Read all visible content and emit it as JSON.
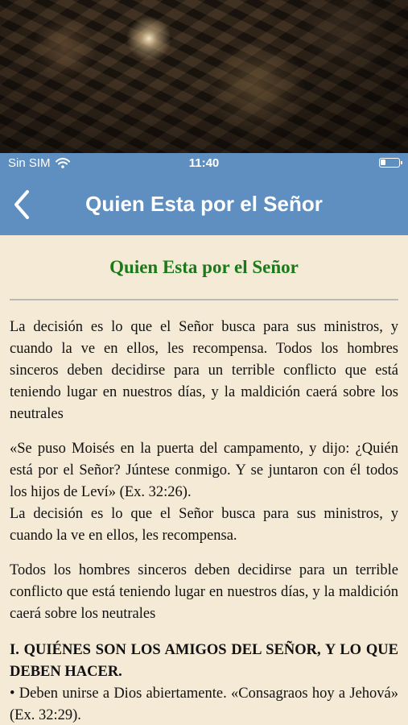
{
  "status": {
    "carrier": "Sin SIM",
    "time": "11:40",
    "icons": [
      "wifi-icon",
      "battery-icon"
    ]
  },
  "nav": {
    "title": "Quien Esta por el Señor",
    "back_icon": "chevron-left-icon"
  },
  "colors": {
    "bar": "#5f8fc0",
    "background": "#f4ead6",
    "title_green": "#1a7a1a"
  },
  "article": {
    "title": "Quien Esta por el Señor",
    "paragraphs": [
      "La decisión es lo que el Señor busca para sus ministros, y cuando la ve en ellos, les recompensa. Todos los hombres sinceros deben decidirse para un terrible conflicto que está teniendo lugar en nuestros días, y la maldición caerá sobre los neutrales",
      "«Se puso Moisés en la puerta del campamento, y dijo: ¿Quién está por el Señor? Júntese conmigo. Y se juntaron con él todos los hijos de Leví» (Ex. 32:26).",
      "La decisión es lo que el Señor busca para sus ministros, y cuando la ve en ellos, les recompensa.",
      "Todos los hombres sinceros deben decidirse para un terrible conflicto que está teniendo lugar en nuestros días, y la maldición caerá sobre los neutrales"
    ],
    "heading": "I. QUIÉNES SON LOS AMIGOS DEL SEÑOR, Y LO QUE DEBEN HACER.",
    "bullet": "• Deben unirse a Dios abiertamente. «Consagraos hoy a Jehová» (Ex. 32:29)."
  }
}
